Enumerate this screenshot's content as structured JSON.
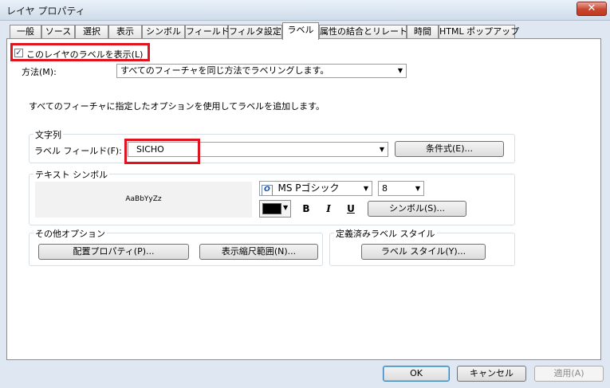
{
  "window": {
    "title": "レイヤ プロパティ",
    "close_glyph": "✕"
  },
  "tabs": [
    {
      "label": "一般"
    },
    {
      "label": "ソース"
    },
    {
      "label": "選択"
    },
    {
      "label": "表示"
    },
    {
      "label": "シンボル"
    },
    {
      "label": "フィールド"
    },
    {
      "label": "フィルタ設定"
    },
    {
      "label": "ラベル",
      "active": true
    },
    {
      "label": "属性の結合とリレート"
    },
    {
      "label": "時間"
    },
    {
      "label": "HTML ポップアップ"
    }
  ],
  "label_page": {
    "show_labels": {
      "label": "このレイヤのラベルを表示(L)",
      "checked": true,
      "check_glyph": "✓"
    },
    "method": {
      "label": "方法(M):",
      "value": "すべてのフィーチャを同じ方法でラベリングします。"
    },
    "description": "すべてのフィーチャに指定したオプションを使用してラベルを追加します。",
    "text_string": {
      "group_title": "文字列",
      "field_label": "ラベル フィールド(F):",
      "field_value": "SICHO",
      "expression_button": "条件式(E)..."
    },
    "text_symbol": {
      "group_title": "テキスト シンボル",
      "preview_text": "AaBbYyZz",
      "font_name": "MS Pゴシック",
      "font_icon_glyph": "O",
      "font_size": "8",
      "color": "#000000",
      "bold": "B",
      "italic": "I",
      "underline": "U",
      "symbol_button": "シンボル(S)..."
    },
    "other_options": {
      "group_title": "その他オプション",
      "placement_button": "配置プロパティ(P)...",
      "scale_range_button": "表示縮尺範囲(N)..."
    },
    "predefined_style": {
      "group_title": "定義済みラベル スタイル",
      "label_style_button": "ラベル スタイル(Y)..."
    }
  },
  "footer": {
    "ok": "OK",
    "cancel": "キャンセル",
    "apply": "適用(A)"
  },
  "icons": {
    "dropdown": "▼"
  }
}
